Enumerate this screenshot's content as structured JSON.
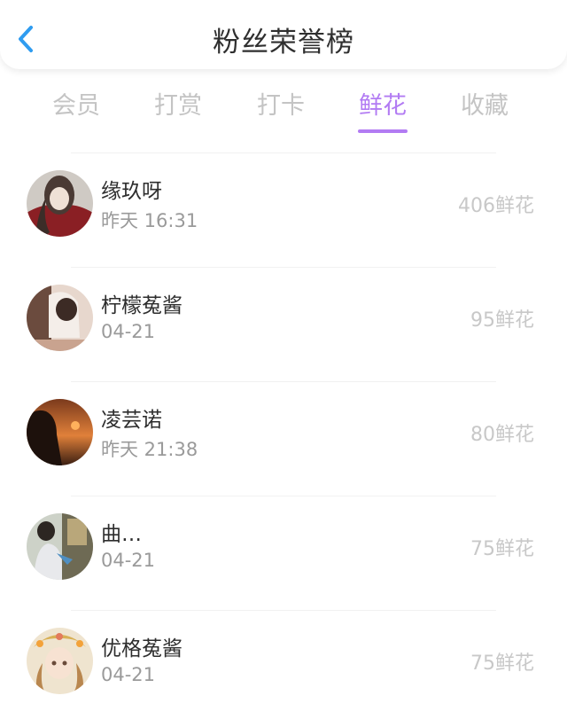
{
  "header": {
    "title": "粉丝荣誉榜",
    "back_icon": "chevron-left-icon",
    "accent_color": "#2f9cf0"
  },
  "tabs": [
    {
      "label": "会员",
      "active": false
    },
    {
      "label": "打赏",
      "active": false
    },
    {
      "label": "打卡",
      "active": false
    },
    {
      "label": "鲜花",
      "active": true
    },
    {
      "label": "收藏",
      "active": false
    }
  ],
  "active_tab_color": "#b27bf3",
  "fans": [
    {
      "name": "缘玖呀",
      "time": "昨天 16:31",
      "amount": "406鲜花"
    },
    {
      "name": "柠檬菟酱",
      "time": "04-21",
      "amount": "95鲜花"
    },
    {
      "name": "凌芸诺",
      "time": "昨天 21:38",
      "amount": "80鲜花"
    },
    {
      "name": "曲…",
      "time": "04-21",
      "amount": "75鲜花"
    },
    {
      "name": "优格菟酱",
      "time": "04-21",
      "amount": "75鲜花"
    }
  ]
}
